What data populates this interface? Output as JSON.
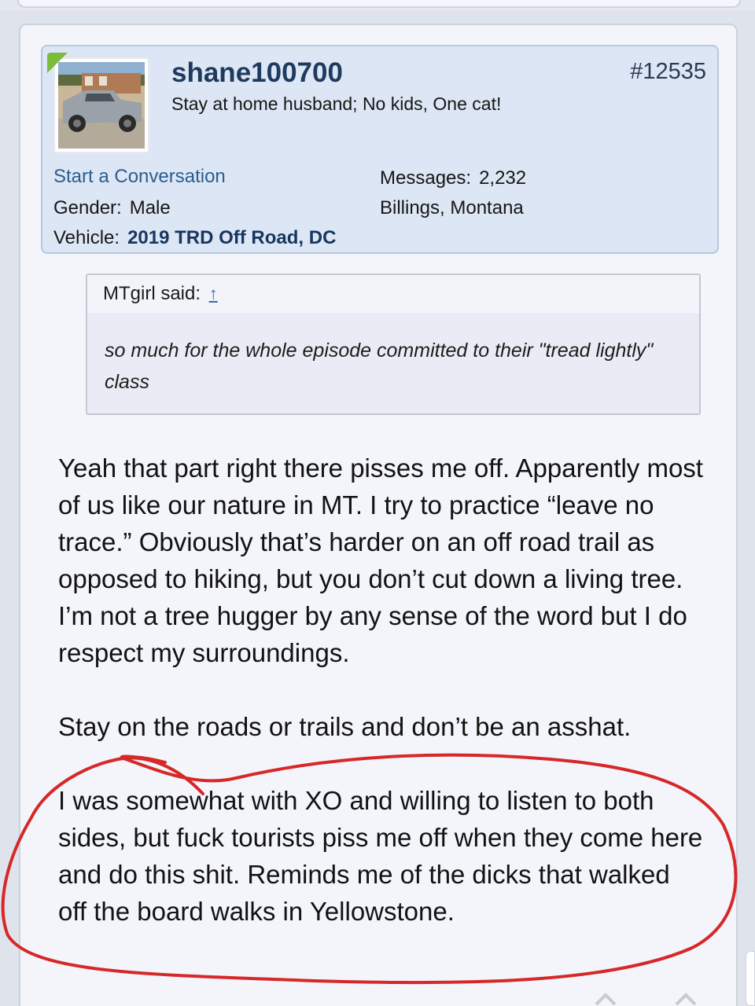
{
  "post": {
    "number": "#12535",
    "author": {
      "username": "shane100700",
      "user_title": "Stay at home husband; No kids, One cat!",
      "start_conversation": "Start a Conversation",
      "gender_label": "Gender:",
      "gender_value": "Male",
      "vehicle_label": "Vehicle:",
      "vehicle_value": "2019 TRD Off Road, DC",
      "messages_label": "Messages:",
      "messages_value": "2,232",
      "location": "Billings, Montana"
    },
    "quote": {
      "author_said": "MTgirl said:",
      "jump_icon": "up-arrow-icon",
      "text": "so much for the whole episode committed to their \"tread lightly\" class"
    },
    "paragraphs": [
      "Yeah that part right there pisses me off. Apparently most of us like our nature in MT. I try to practice “leave no trace.” Obviously that’s harder on an off road trail as opposed to hiking, but you don’t cut down a living tree. I’m not a tree hugger by any sense of the word but I do respect my surroundings.",
      "Stay on the roads or trails and don’t be an asshat.",
      "I was somewhat with XO and willing to listen to both sides, but fuck tourists piss me off when they come here and do this shit. Reminds me of the dicks that walked off the board walks in Yellowstone."
    ]
  },
  "colors": {
    "accent": "#2b5d8f",
    "card_background": "#dce6f4",
    "annotation": "#d62828",
    "online": "#7cbc3a"
  }
}
